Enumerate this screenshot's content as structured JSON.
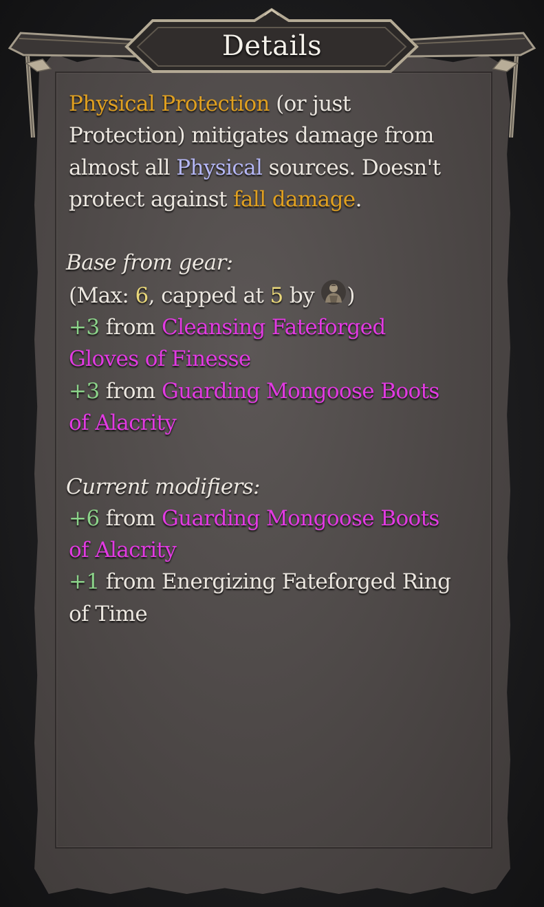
{
  "window": {
    "title": "Details"
  },
  "intro": {
    "term_protection": "Physical Protection",
    "text_1": " (or just",
    "text_2": "Protection) mitigates damage from",
    "text_3": "almost all ",
    "term_physical": "Physical",
    "text_4": " sources. Doesn't",
    "text_5": "protect against ",
    "term_fall": "fall damage",
    "text_6": "."
  },
  "base_section": {
    "heading": "Base from gear:",
    "max_prefix": "(Max: ",
    "max_value": "6",
    "capped_text": ", capped at ",
    "cap_value": "5",
    "by_text": " by ",
    "cap_icon": "character-portrait-icon",
    "close_paren": ")",
    "items": [
      {
        "amount": "+3",
        "from": " from ",
        "name_line1": "Cleansing Fateforged",
        "name_line2": "Gloves of Finesse"
      },
      {
        "amount": "+3",
        "from": " from ",
        "name_line1": "Guarding Mongoose Boots",
        "name_line2": "of Alacrity"
      }
    ]
  },
  "modifiers_section": {
    "heading": "Current modifiers:",
    "items": [
      {
        "amount": "+6",
        "from": " from ",
        "name_line1": "Guarding Mongoose Boots",
        "name_line2": "of Alacrity"
      },
      {
        "amount": "+1",
        "from": " from ",
        "name_line1": "Energizing Fateforged Ring",
        "name_line2": "of Time"
      }
    ]
  },
  "colors": {
    "keyword_gold": "#e0a020",
    "keyword_physical": "#b5b7f5",
    "number_yellow": "#ead87a",
    "bonus_green": "#8cd48a",
    "item_magenta": "#e23ae2",
    "text": "#ece7e0"
  }
}
